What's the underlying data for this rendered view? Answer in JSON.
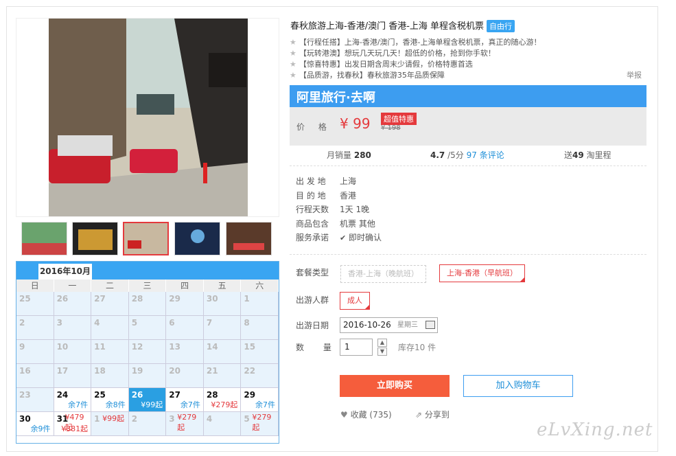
{
  "product": {
    "title": "春秋旅游上海-香港/澳门 香港-上海 单程含税机票",
    "badge": "自由行",
    "features": [
      "【行程任搭】上海-香港/澳门，香港-上海单程含税机票，真正的随心游！",
      "【玩转港澳】想玩几天玩几天！超低的价格，抢到你手软！",
      "【惊喜特惠】出发日期含周末少请假，价格特惠首选",
      "【品质游，找春秋】春秋旅游35年品质保障"
    ],
    "report": "举报"
  },
  "brand": {
    "name": "阿里旅行·去啊",
    "color": "#3d9df0"
  },
  "price": {
    "label": "价 格",
    "currency": "¥",
    "value": "99",
    "deal": "超值特惠",
    "original": "¥ 198"
  },
  "stats": {
    "monthly_label": "月销量",
    "monthly": "280",
    "rating": "4.7",
    "rating_max": "/5分",
    "reviews": "97 条评论",
    "miles_prefix": "送",
    "miles": "49",
    "miles_suffix": "淘里程"
  },
  "info": [
    {
      "k": "出 发 地",
      "v": "上海"
    },
    {
      "k": "目 的 地",
      "v": "香港"
    },
    {
      "k": "行程天数",
      "v": "1天 1晚"
    },
    {
      "k": "商品包含",
      "v": "机票  其他"
    },
    {
      "k": "服务承诺",
      "v": "即时确认"
    }
  ],
  "form": {
    "package_label": "套餐类型",
    "package_options": [
      "香港-上海（晚航班）",
      "上海-香港（早航班）"
    ],
    "crowd_label": "出游人群",
    "crowd_option": "成人",
    "date_label": "出游日期",
    "date_value": "2016-10-26",
    "date_week": "星期三",
    "qty_label": "数 量",
    "qty_value": "1",
    "stock": "库存10 件",
    "buy": "立即购买",
    "cart": "加入购物车",
    "fav": "收藏 (735)",
    "share": "分享到"
  },
  "calendar": {
    "month": "2016年10月",
    "weekdays": [
      "日",
      "一",
      "二",
      "三",
      "四",
      "五",
      "六"
    ],
    "cells": [
      {
        "d": "25",
        "a": false
      },
      {
        "d": "26",
        "a": false
      },
      {
        "d": "27",
        "a": false
      },
      {
        "d": "28",
        "a": false
      },
      {
        "d": "29",
        "a": false
      },
      {
        "d": "30",
        "a": false
      },
      {
        "d": "1",
        "a": false
      },
      {
        "d": "2",
        "a": false
      },
      {
        "d": "3",
        "a": false
      },
      {
        "d": "4",
        "a": false
      },
      {
        "d": "5",
        "a": false
      },
      {
        "d": "6",
        "a": false
      },
      {
        "d": "7",
        "a": false
      },
      {
        "d": "8",
        "a": false
      },
      {
        "d": "9",
        "a": false
      },
      {
        "d": "10",
        "a": false
      },
      {
        "d": "11",
        "a": false
      },
      {
        "d": "12",
        "a": false
      },
      {
        "d": "13",
        "a": false
      },
      {
        "d": "14",
        "a": false
      },
      {
        "d": "15",
        "a": false
      },
      {
        "d": "16",
        "a": false
      },
      {
        "d": "17",
        "a": false
      },
      {
        "d": "18",
        "a": false
      },
      {
        "d": "19",
        "a": false
      },
      {
        "d": "20",
        "a": false
      },
      {
        "d": "21",
        "a": false
      },
      {
        "d": "22",
        "a": false
      },
      {
        "d": "23",
        "a": false
      },
      {
        "d": "24",
        "a": true,
        "s": "余7件",
        "c": "blue"
      },
      {
        "d": "25",
        "a": true,
        "s": "余8件",
        "c": "blue"
      },
      {
        "d": "26",
        "a": true,
        "sel": true,
        "s": "¥99起",
        "c": "blue"
      },
      {
        "d": "27",
        "a": true,
        "s": "余7件",
        "c": "blue"
      },
      {
        "d": "28",
        "a": true,
        "s": "¥279起",
        "c": "red"
      },
      {
        "d": "29",
        "a": true,
        "s": "余7件",
        "c": "blue"
      },
      {
        "d": "30",
        "a": true,
        "s": "余9件",
        "c": "blue"
      },
      {
        "d": "31",
        "a": true,
        "s": "¥381起",
        "c": "red",
        "s2": "¥479起"
      },
      {
        "d": "1",
        "a": false,
        "s2": "¥99起"
      },
      {
        "d": "2",
        "a": false,
        "s2": ""
      },
      {
        "d": "3",
        "a": false,
        "s2": "¥279起"
      },
      {
        "d": "4",
        "a": false
      },
      {
        "d": "5",
        "a": false,
        "s2": "¥279起"
      }
    ]
  },
  "watermark": "eLvXing.net"
}
